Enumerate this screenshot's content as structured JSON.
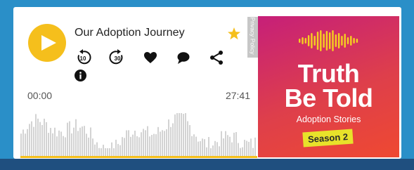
{
  "player": {
    "title": "Our Adoption Journey",
    "time_elapsed": "00:00",
    "time_total": "27:41",
    "privacy_label": "Privacy Policy",
    "progress": 0
  },
  "controls": [
    {
      "name": "rewind-10-icon",
      "label": "10"
    },
    {
      "name": "forward-30-icon",
      "label": "30"
    },
    {
      "name": "heart-icon"
    },
    {
      "name": "comment-icon"
    },
    {
      "name": "share-icon"
    }
  ],
  "artwork": {
    "line1": "Truth",
    "line2": "Be Told",
    "subtitle": "Adoption Stories",
    "season": "Season 2"
  },
  "colors": {
    "accent": "#f5bf1c",
    "text": "#222222",
    "waveform": "#d3d3d3",
    "artwork_top": "#c61f79",
    "artwork_bottom": "#ef4931",
    "season_badge": "#e8e22a",
    "page_background": "#2a8fc8"
  }
}
